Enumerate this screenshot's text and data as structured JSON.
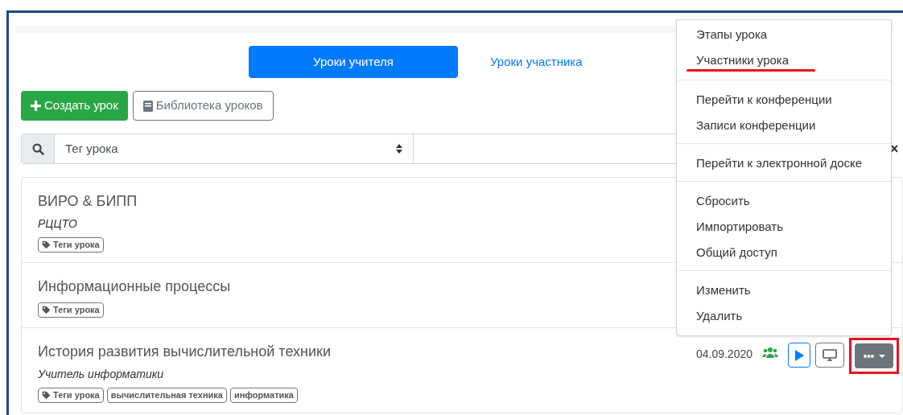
{
  "tabs": [
    {
      "label": "Уроки учителя",
      "selected": true
    },
    {
      "label": "Уроки участника",
      "selected": false
    }
  ],
  "toolbar": {
    "create_button": "Создать урок",
    "library_button": "Библиотека уроков"
  },
  "filter": {
    "tag_select": "Тег урока",
    "clear": "×"
  },
  "lessons": [
    {
      "title": "ВИРО & БИПП",
      "author": "РЦЦТО",
      "tags": [
        {
          "label": "Теги урока",
          "kind": "header"
        }
      ]
    },
    {
      "title": "Информационные процессы",
      "tags": [
        {
          "label": "Теги урока",
          "kind": "header"
        }
      ]
    },
    {
      "title": "История развития вычислительной техники",
      "author": "Учитель информатики",
      "date": "04.09.2020",
      "tags": [
        {
          "label": "Теги урока",
          "kind": "header"
        },
        {
          "label": "вычислительная техника",
          "kind": "tag"
        },
        {
          "label": "информатика",
          "kind": "tag"
        }
      ],
      "more_highlighted": true
    }
  ],
  "menu": {
    "groups": [
      [
        {
          "label": "Этапы урока",
          "highlighted": false
        },
        {
          "label": "Участники урока",
          "highlighted": true
        }
      ],
      [
        {
          "label": "Перейти к конференции",
          "highlighted": false
        },
        {
          "label": "Записи конференции",
          "highlighted": false
        }
      ],
      [
        {
          "label": "Перейти к электронной доске",
          "highlighted": false
        }
      ],
      [
        {
          "label": "Сбросить",
          "highlighted": false
        },
        {
          "label": "Импортировать",
          "highlighted": false
        },
        {
          "label": "Общий доступ",
          "highlighted": false
        }
      ],
      [
        {
          "label": "Изменить",
          "highlighted": false
        },
        {
          "label": "Удалить",
          "highlighted": false
        }
      ]
    ]
  }
}
